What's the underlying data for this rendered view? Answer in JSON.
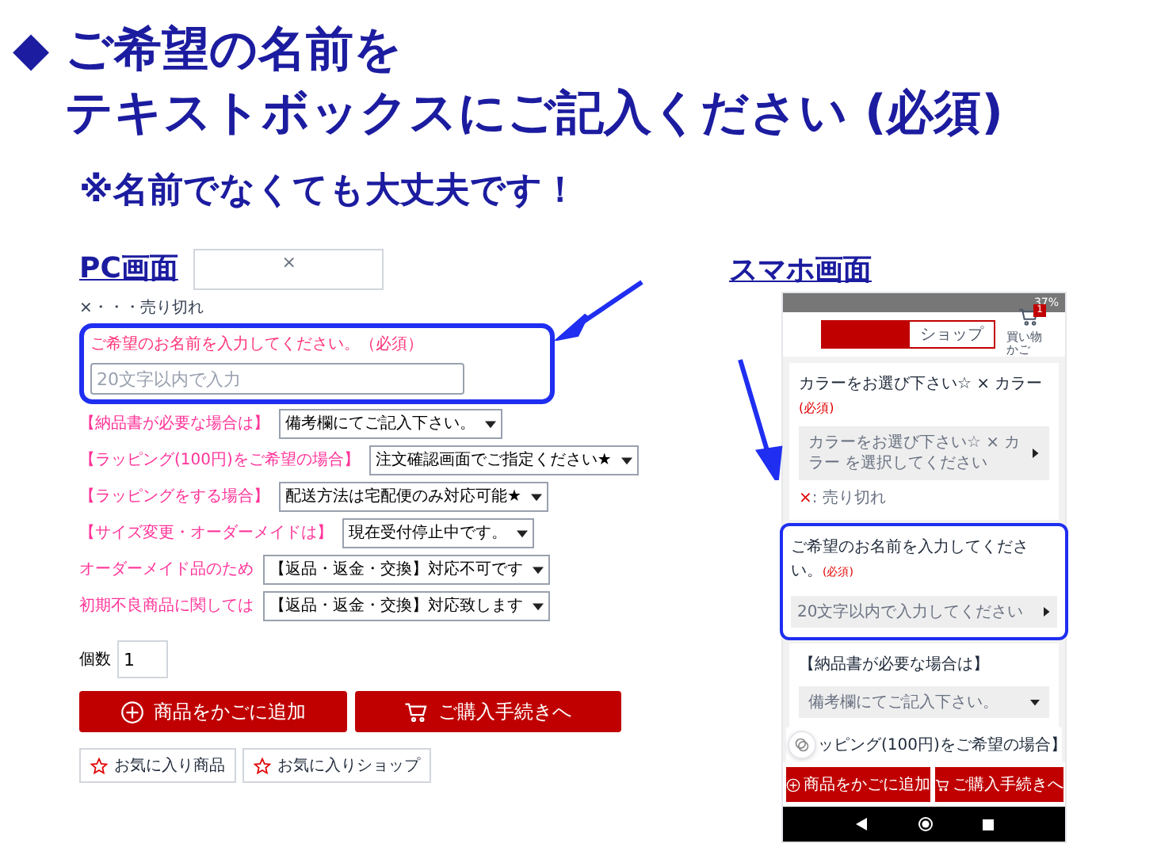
{
  "heading": {
    "marker": "◆",
    "lines": [
      "ご希望の名前を",
      "テキストボックスにご記入ください (必須)"
    ],
    "note": "※名前でなくても大丈夫です！"
  },
  "pc": {
    "label": "PC画面",
    "image_mark": "×",
    "sold_out": "×・・・売り切れ",
    "name_field": {
      "label": "ご希望のお名前を入力してください。（必須）",
      "placeholder": "20文字以内で入力"
    },
    "options": [
      {
        "label": "【納品書が必要な場合は】",
        "value": "備考欄にてご記入下さい。"
      },
      {
        "label": "【ラッピング(100円)をご希望の場合】",
        "value": "注文確認画面でご指定ください★"
      },
      {
        "label": "【ラッピングをする場合】",
        "value": "配送方法は宅配便のみ対応可能★"
      },
      {
        "label": "【サイズ変更・オーダーメイドは】",
        "value": "現在受付停止中です。"
      },
      {
        "label": "オーダーメイド品のため",
        "value": "【返品・返金・交換】対応不可です"
      },
      {
        "label": "初期不良商品に関しては",
        "value": "【返品・返金・交換】対応致します"
      }
    ],
    "quantity": {
      "label": "個数",
      "value": "1"
    },
    "buttons": [
      {
        "kind": "add",
        "label": "商品をかごに追加"
      },
      {
        "kind": "cart",
        "label": "ご購入手続きへ"
      }
    ],
    "favorites": [
      "お気に入り商品",
      "お気に入りショップ"
    ]
  },
  "phone": {
    "label": "スマホ画面",
    "battery": "37%",
    "tabs": [
      {
        "selected": true
      },
      {
        "label": "ショップ",
        "selected": false
      }
    ],
    "cart_badge": "1",
    "cart_label": "買い物かご",
    "color_section": {
      "title": "カラーをお選び下さい☆ × カラー",
      "required": "(必須)",
      "select": "カラーをお選び下さい☆ × カラー を選択してください",
      "sold_mark": "×",
      "sold_text": ": 売り切れ"
    },
    "name_section": {
      "title": "ご希望のお名前を入力してください。",
      "required": "(必須)",
      "placeholder": "20文字以内で入力してください"
    },
    "invoice_section": {
      "title": "【納品書が必要な場合は】",
      "select": "備考欄にてご記入下さい。"
    },
    "wrapping_title": "ッピング(100円)をご希望の場合】",
    "buttons": [
      {
        "kind": "add",
        "label": "商品をかごに追加"
      },
      {
        "kind": "cart",
        "label": "ご購入手続きへ"
      }
    ]
  }
}
